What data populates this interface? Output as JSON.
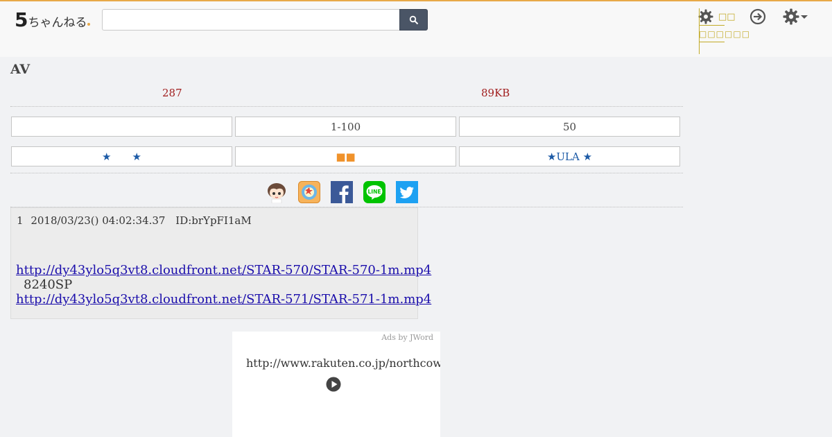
{
  "header": {
    "logo_big": "5",
    "logo_small": "ちゃんねる",
    "search": {
      "value": "",
      "placeholder": ""
    },
    "menu_label_top": "□□",
    "menu_label_bottom": "□□□□□□"
  },
  "thread": {
    "title": "AV",
    "res_count": "287",
    "size": "89KB"
  },
  "nav_row1": [
    "",
    "1-100",
    "50"
  ],
  "nav_row2": [
    "★　　★",
    "■■",
    "★ULA ★"
  ],
  "share_icons": [
    "mascot",
    "app",
    "facebook",
    "line",
    "twitter"
  ],
  "post": {
    "number": "1",
    "date": "2018/03/23() 04:02:34.37",
    "id": "ID:brYpFI1aM",
    "link1": "http://dy43ylo5q3vt8.cloudfront.net/STAR-570/STAR-570-1m.mp4",
    "text": "8240SP",
    "link2": "http://dy43ylo5q3vt8.cloudfront.net/STAR-571/STAR-571-1m.mp4"
  },
  "ad": {
    "label": "Ads by JWord",
    "url": "http://www.rakuten.co.jp/northcow"
  },
  "colors": {
    "accent": "#e8a948",
    "counts": "#a11e1e",
    "link": "#1a0dab",
    "menu": "#c2aa27",
    "search_button": "#4a5566"
  }
}
